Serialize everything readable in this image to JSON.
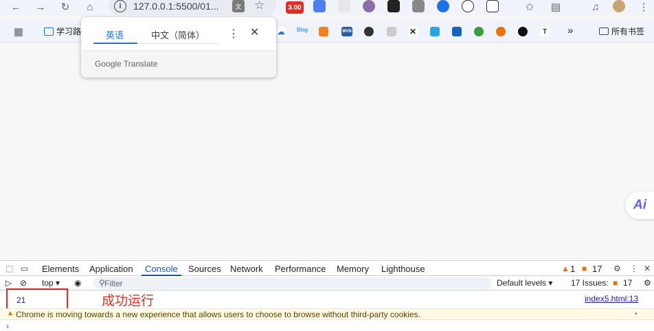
{
  "browser": {
    "url": "127.0.0.1:5500/01...",
    "ext_badge": "3.00"
  },
  "bookmarks": {
    "first_label": "学习路",
    "blog_label": "Blog",
    "mvn_label": "MVN",
    "overflow": "»",
    "all_bookmarks": "所有书签"
  },
  "translate_popup": {
    "tab_source": "英语",
    "tab_target": "中文（简体）",
    "footer": "Google Translate"
  },
  "page": {
    "ai_button": "Ai"
  },
  "devtools": {
    "tabs": [
      "Elements",
      "Application",
      "Console",
      "Sources",
      "Network",
      "Performance",
      "Memory",
      "Lighthouse"
    ],
    "active_tab": "Console",
    "warning_count": "1",
    "issue_count": "17",
    "context": "top ▾",
    "filter_placeholder": "Filter",
    "levels": "Default levels ▾",
    "issues_label": "17 Issues:",
    "issues_count": "17",
    "log_value": "21",
    "log_source": "index5.html:13",
    "annotation": "成功运行",
    "warning_message": "Chrome is moving towards a new experience that allows users to choose to browse without third-party cookies.",
    "prompt": "›"
  },
  "colors": {
    "accent": "#1a73e8",
    "annotation": "#e0301e",
    "warning_bg": "#fffbe5"
  }
}
